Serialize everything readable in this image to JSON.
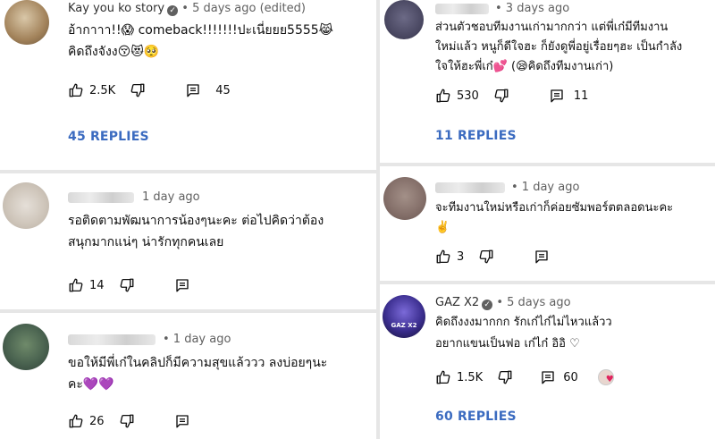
{
  "comments": [
    {
      "meta": "Kay you ko story",
      "verified": true,
      "time": "• 5 days ago (edited)",
      "line1": "อ้ากาาา!!😱 comeback!!!!!!!ปะเนี่ยยย5555😹",
      "line2": "คิดถึงจังง😚😻🥺",
      "likes": "2.5K",
      "replies_count": "45",
      "replies_label": "45 REPLIES"
    },
    {
      "time": "1 day ago",
      "line1": "รอติดตามพัฒนาการน้องๆนะคะ ต่อไปคิดว่าต้อง",
      "line2": "สนุกมากแน่ๆ น่ารักทุกคนเลย",
      "likes": "14"
    },
    {
      "time": "• 1 day ago",
      "line1": "ขอให้มีพี่เก๋ในคลิปก็มีความสุขแล้ววว ลงบ่อยๆนะ",
      "line2": "คะ💜💜",
      "likes": "26"
    },
    {
      "time": "• 3 days ago",
      "line1": "ส่วนตัวชอบทีมงานเก่ามากกว่า แต่พี่เก๋มีทีมงาน",
      "line2": "ใหม่แล้ว หนูก็ดีใจฮะ ก็ยังดูพี่อยู่เรื่อยๆฮะ เป็นกำลัง",
      "line3": "ใจให้ฮะพี่เก๋💕 (😪คิดถึงทีมงานเก่า)",
      "likes": "530",
      "replies_count": "11",
      "replies_label": "11 REPLIES"
    },
    {
      "time": "• 1 day ago",
      "line1": "จะทีมงานใหม่หรือเก่าก็ค่อยซัมพอร์ตตลอดนะคะ",
      "line2": "✌️",
      "likes": "3"
    },
    {
      "meta": "GAZ X2",
      "verified": true,
      "time": "• 5 days ago",
      "line1": "คิดถึงงงมากกก รักเก๋ไก๋ไม่ไหวแล้วว",
      "line2": "อยากแขนเป็นฟอ เก๋ไก๋ อิอิ ♡",
      "likes": "1.5K",
      "replies_count": "60",
      "replies_label": "60 REPLIES",
      "avatar_text": "GAZ X2"
    }
  ],
  "icons": {
    "like": "thumb-up-icon",
    "dislike": "thumb-down-icon",
    "reply": "reply-icon",
    "verified": "verified-check-icon",
    "creator_heart": "creator-heart-icon"
  },
  "colors": {
    "replies_link": "#3b6bc0",
    "meta_gray": "#606060",
    "separator": "#e6e6e6"
  }
}
